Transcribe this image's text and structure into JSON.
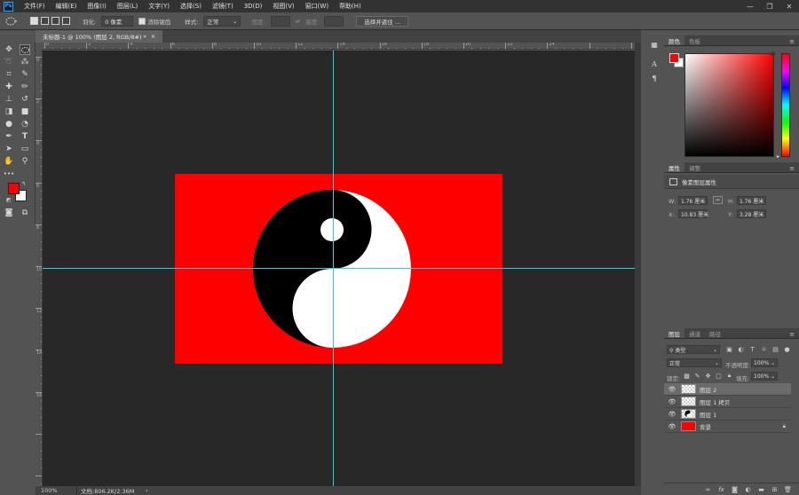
{
  "app": {
    "logo": "Ps"
  },
  "menu": [
    "文件(F)",
    "编辑(E)",
    "图像(I)",
    "图层(L)",
    "文字(Y)",
    "选择(S)",
    "滤镜(T)",
    "3D(D)",
    "视图(V)",
    "窗口(W)",
    "帮助(H)"
  ],
  "window_controls": [
    "—",
    "❐",
    "✕"
  ],
  "options": {
    "feather_label": "羽化:",
    "feather_value": "0 像素",
    "antialias_label": "消除锯齿",
    "style_label": "样式:",
    "style_value": "正常",
    "width_label": "宽度:",
    "height_label": "高度:",
    "select_mask_button": "选择并遮住 ..."
  },
  "document": {
    "tab_title": "未标题-1 @ 100% (图层 2, RGB/8#) *",
    "tab_close": "×"
  },
  "rulers": {
    "top": [
      "0",
      "2",
      "4",
      "6",
      "8",
      "10",
      "12",
      "14",
      "16",
      "18",
      "20",
      "22",
      "24"
    ],
    "left": [
      "0",
      "2",
      "4",
      "6",
      "8",
      "10",
      "12",
      "14",
      "16"
    ]
  },
  "status": {
    "zoom": "100%",
    "doc_info": "文档:806.2K/2.36M",
    "arrow": "›"
  },
  "colors": {
    "foreground": "#ff0000",
    "background": "#ffffff",
    "canvas_bg": "#ff0000",
    "guide": "#28d0e0"
  },
  "color_panel": {
    "tabs": [
      "颜色",
      "色板"
    ],
    "fg_color": "#ff0000",
    "bg_color": "#ffffff"
  },
  "properties_panel": {
    "tabs": [
      "属性",
      "调整"
    ],
    "title": "像素图层属性",
    "w_label": "W:",
    "w_value": "1.76 厘米",
    "h_label": "H:",
    "h_value": "1.76 厘米",
    "x_label": "X:",
    "x_value": "10.83 厘米",
    "y_label": "Y:",
    "y_value": "3.28 厘米"
  },
  "layers_panel": {
    "tabs": [
      "图层",
      "通道",
      "路径"
    ],
    "filter_kind": "类型",
    "blend_mode": "正常",
    "opacity_label": "不透明度:",
    "opacity_value": "100%",
    "lock_label": "锁定:",
    "fill_label": "填充:",
    "fill_value": "100%",
    "layers": [
      {
        "name": "图层 2",
        "selected": true,
        "thumb": "checker"
      },
      {
        "name": "图层 1 拷贝",
        "selected": false,
        "thumb": "checker"
      },
      {
        "name": "图层 1",
        "selected": false,
        "thumb": "yinyang"
      },
      {
        "name": "背景",
        "selected": false,
        "thumb": "red"
      }
    ],
    "footer_icons": [
      "link-icon",
      "fx-icon",
      "mask-icon",
      "adjustment-icon",
      "group-icon",
      "new-layer-icon",
      "trash-icon"
    ]
  }
}
